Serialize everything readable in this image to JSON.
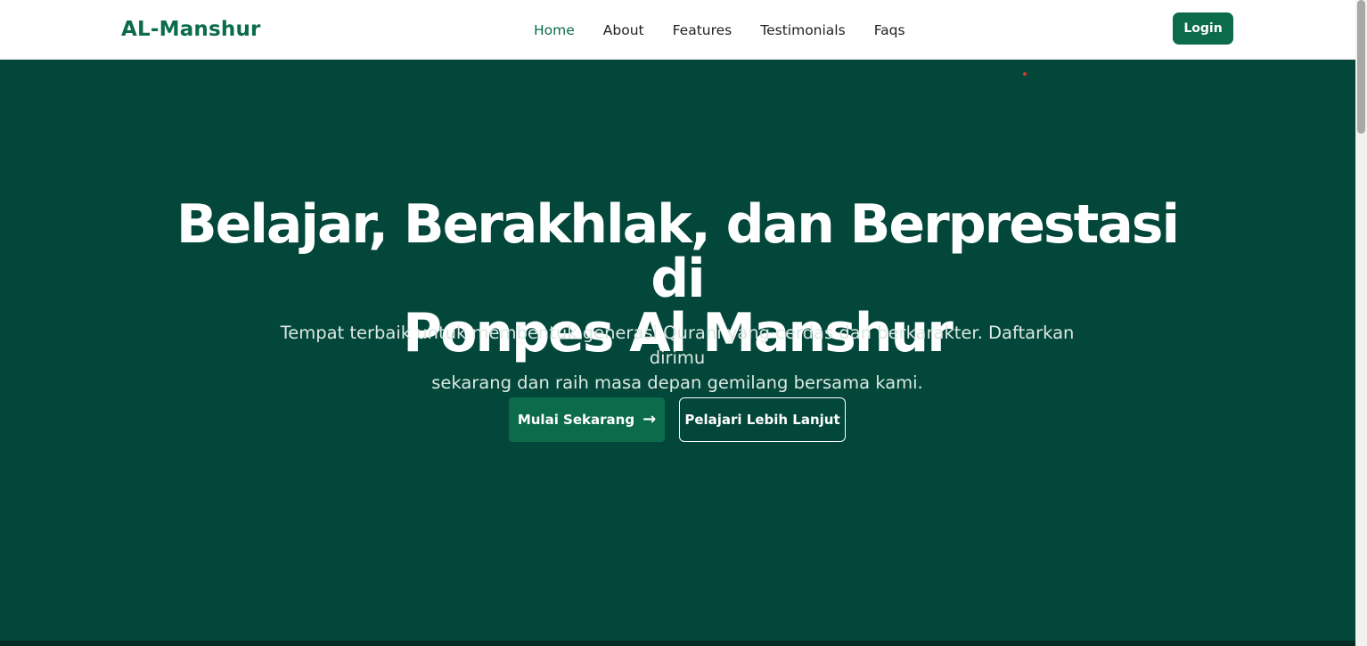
{
  "navbar": {
    "logo": "AL-Manshur",
    "links": [
      {
        "label": "Home",
        "active": true
      },
      {
        "label": "About",
        "active": false
      },
      {
        "label": "Features",
        "active": false
      },
      {
        "label": "Testimonials",
        "active": false
      },
      {
        "label": "Faqs",
        "active": false
      }
    ],
    "login_label": "Login"
  },
  "hero": {
    "title_line1": "Belajar, Berakhlak, dan Berprestasi di",
    "title_line2": "Ponpes Al Manshur",
    "subtitle_line1": "Tempat terbaik untuk membentuk generasi Qurani yang cerdas dan berkarakter. Daftarkan dirimu",
    "subtitle_line2": "sekarang dan raih masa depan gemilang bersama kami.",
    "primary_button": "Mulai Sekarang",
    "primary_button_icon": "arrow-right-icon",
    "primary_arrow_glyph": "→",
    "secondary_button": "Pelajari Lebih Lanjut"
  },
  "colors": {
    "brand": "#0b6b4a",
    "hero_bg": "#02473a",
    "text_white": "#ffffff"
  }
}
